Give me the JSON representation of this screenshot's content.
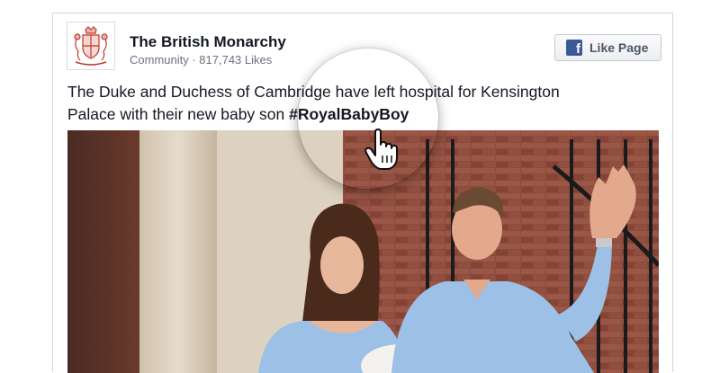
{
  "post": {
    "page_name": "The British Monarchy",
    "meta": "Community · 817,743 Likes",
    "like_button_label": "Like Page",
    "text_before": "The Duke and Duchess of Cambridge have left hospital for Kensington Palace with their new baby son ",
    "hashtag": "#RoyalBabyBoy"
  },
  "icons": {
    "logo": "royal-coat-of-arms",
    "like": "facebook-icon",
    "cursor": "hand-pointer-icon"
  },
  "colors": {
    "facebook_blue": "#3b5998",
    "brick": "#8a4a38",
    "shirt": "#9cc0e6"
  }
}
